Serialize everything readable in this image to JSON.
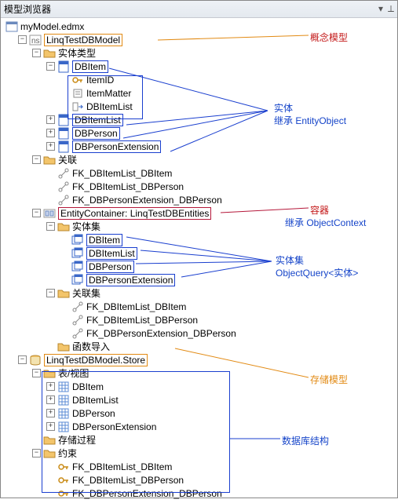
{
  "window": {
    "title": "模型浏览器"
  },
  "root": {
    "label": "myModel.edmx"
  },
  "conceptual": {
    "label": "LinqTestDBModel",
    "entityTypesLabel": "实体类型",
    "dbItem": {
      "label": "DBItem",
      "props": [
        "ItemID",
        "ItemMatter",
        "DBItemList"
      ]
    },
    "entities": [
      "DBItemList",
      "DBPerson",
      "DBPersonExtension"
    ],
    "assocLabel": "关联",
    "assocs": [
      "FK_DBItemList_DBItem",
      "FK_DBItemList_DBPerson",
      "FK_DBPersonExtension_DBPerson"
    ]
  },
  "container": {
    "label": "EntityContainer: LinqTestDBEntities",
    "setsLabel": "实体集",
    "sets": [
      "DBItem",
      "DBItemList",
      "DBPerson",
      "DBPersonExtension"
    ],
    "assocSetsLabel": "关联集",
    "assocSets": [
      "FK_DBItemList_DBItem",
      "FK_DBItemList_DBPerson",
      "FK_DBPersonExtension_DBPerson"
    ],
    "funcLabel": "函数导入"
  },
  "store": {
    "label": "LinqTestDBModel.Store",
    "tablesLabel": "表/视图",
    "tables": [
      "DBItem",
      "DBItemList",
      "DBPerson",
      "DBPersonExtension"
    ],
    "procLabel": "存储过程",
    "constraintsLabel": "约束",
    "constraints": [
      "FK_DBItemList_DBItem",
      "FK_DBItemList_DBPerson",
      "FK_DBPersonExtension_DBPerson"
    ]
  },
  "annos": {
    "conceptModel": "概念模型",
    "entity": "实体",
    "entityInherit": "继承 EntityObject",
    "container": "容器",
    "containerInherit": "继承  ObjectContext",
    "entitySet": "实体集",
    "entitySetType": "ObjectQuery<实体>",
    "storageModel": "存储模型",
    "dbStructure": "数据库结构"
  }
}
